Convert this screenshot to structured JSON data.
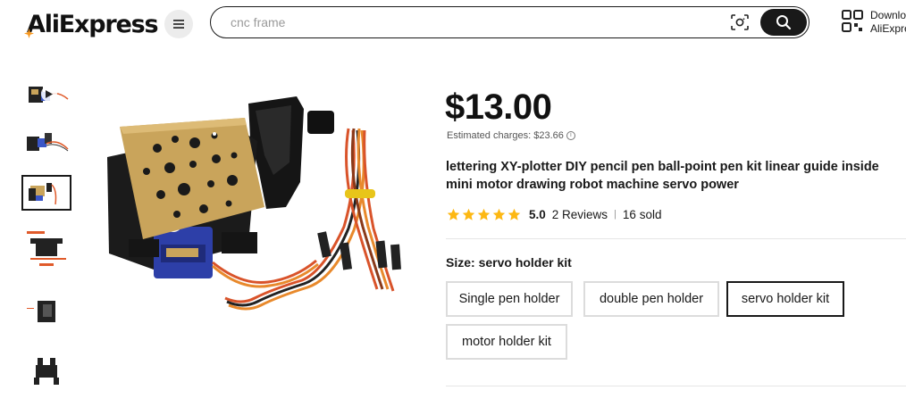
{
  "header": {
    "logo_text": "AliExpress",
    "search_placeholder": "cnc frame",
    "download_line1": "Download the",
    "download_line2": "AliExpress app"
  },
  "product": {
    "price": "$13.00",
    "estimated_charges": "Estimated charges: $23.66",
    "title": "lettering XY-plotter DIY pencil pen ball-point pen kit linear guide inside mini motor drawing robot machine servo power",
    "rating": "5.0",
    "reviews": "2 Reviews",
    "separator": "|",
    "sold": "16 sold",
    "stars": 5
  },
  "size": {
    "label": "Size: servo holder kit",
    "options": [
      {
        "label": "Single pen holder",
        "selected": false
      },
      {
        "label": "double pen holder",
        "selected": false
      },
      {
        "label": "servo holder kit",
        "selected": true
      },
      {
        "label": "motor holder kit",
        "selected": false
      }
    ]
  },
  "colors": {
    "accent": "#191919",
    "star": "#fdb813",
    "logo_star": "#f7971e"
  }
}
